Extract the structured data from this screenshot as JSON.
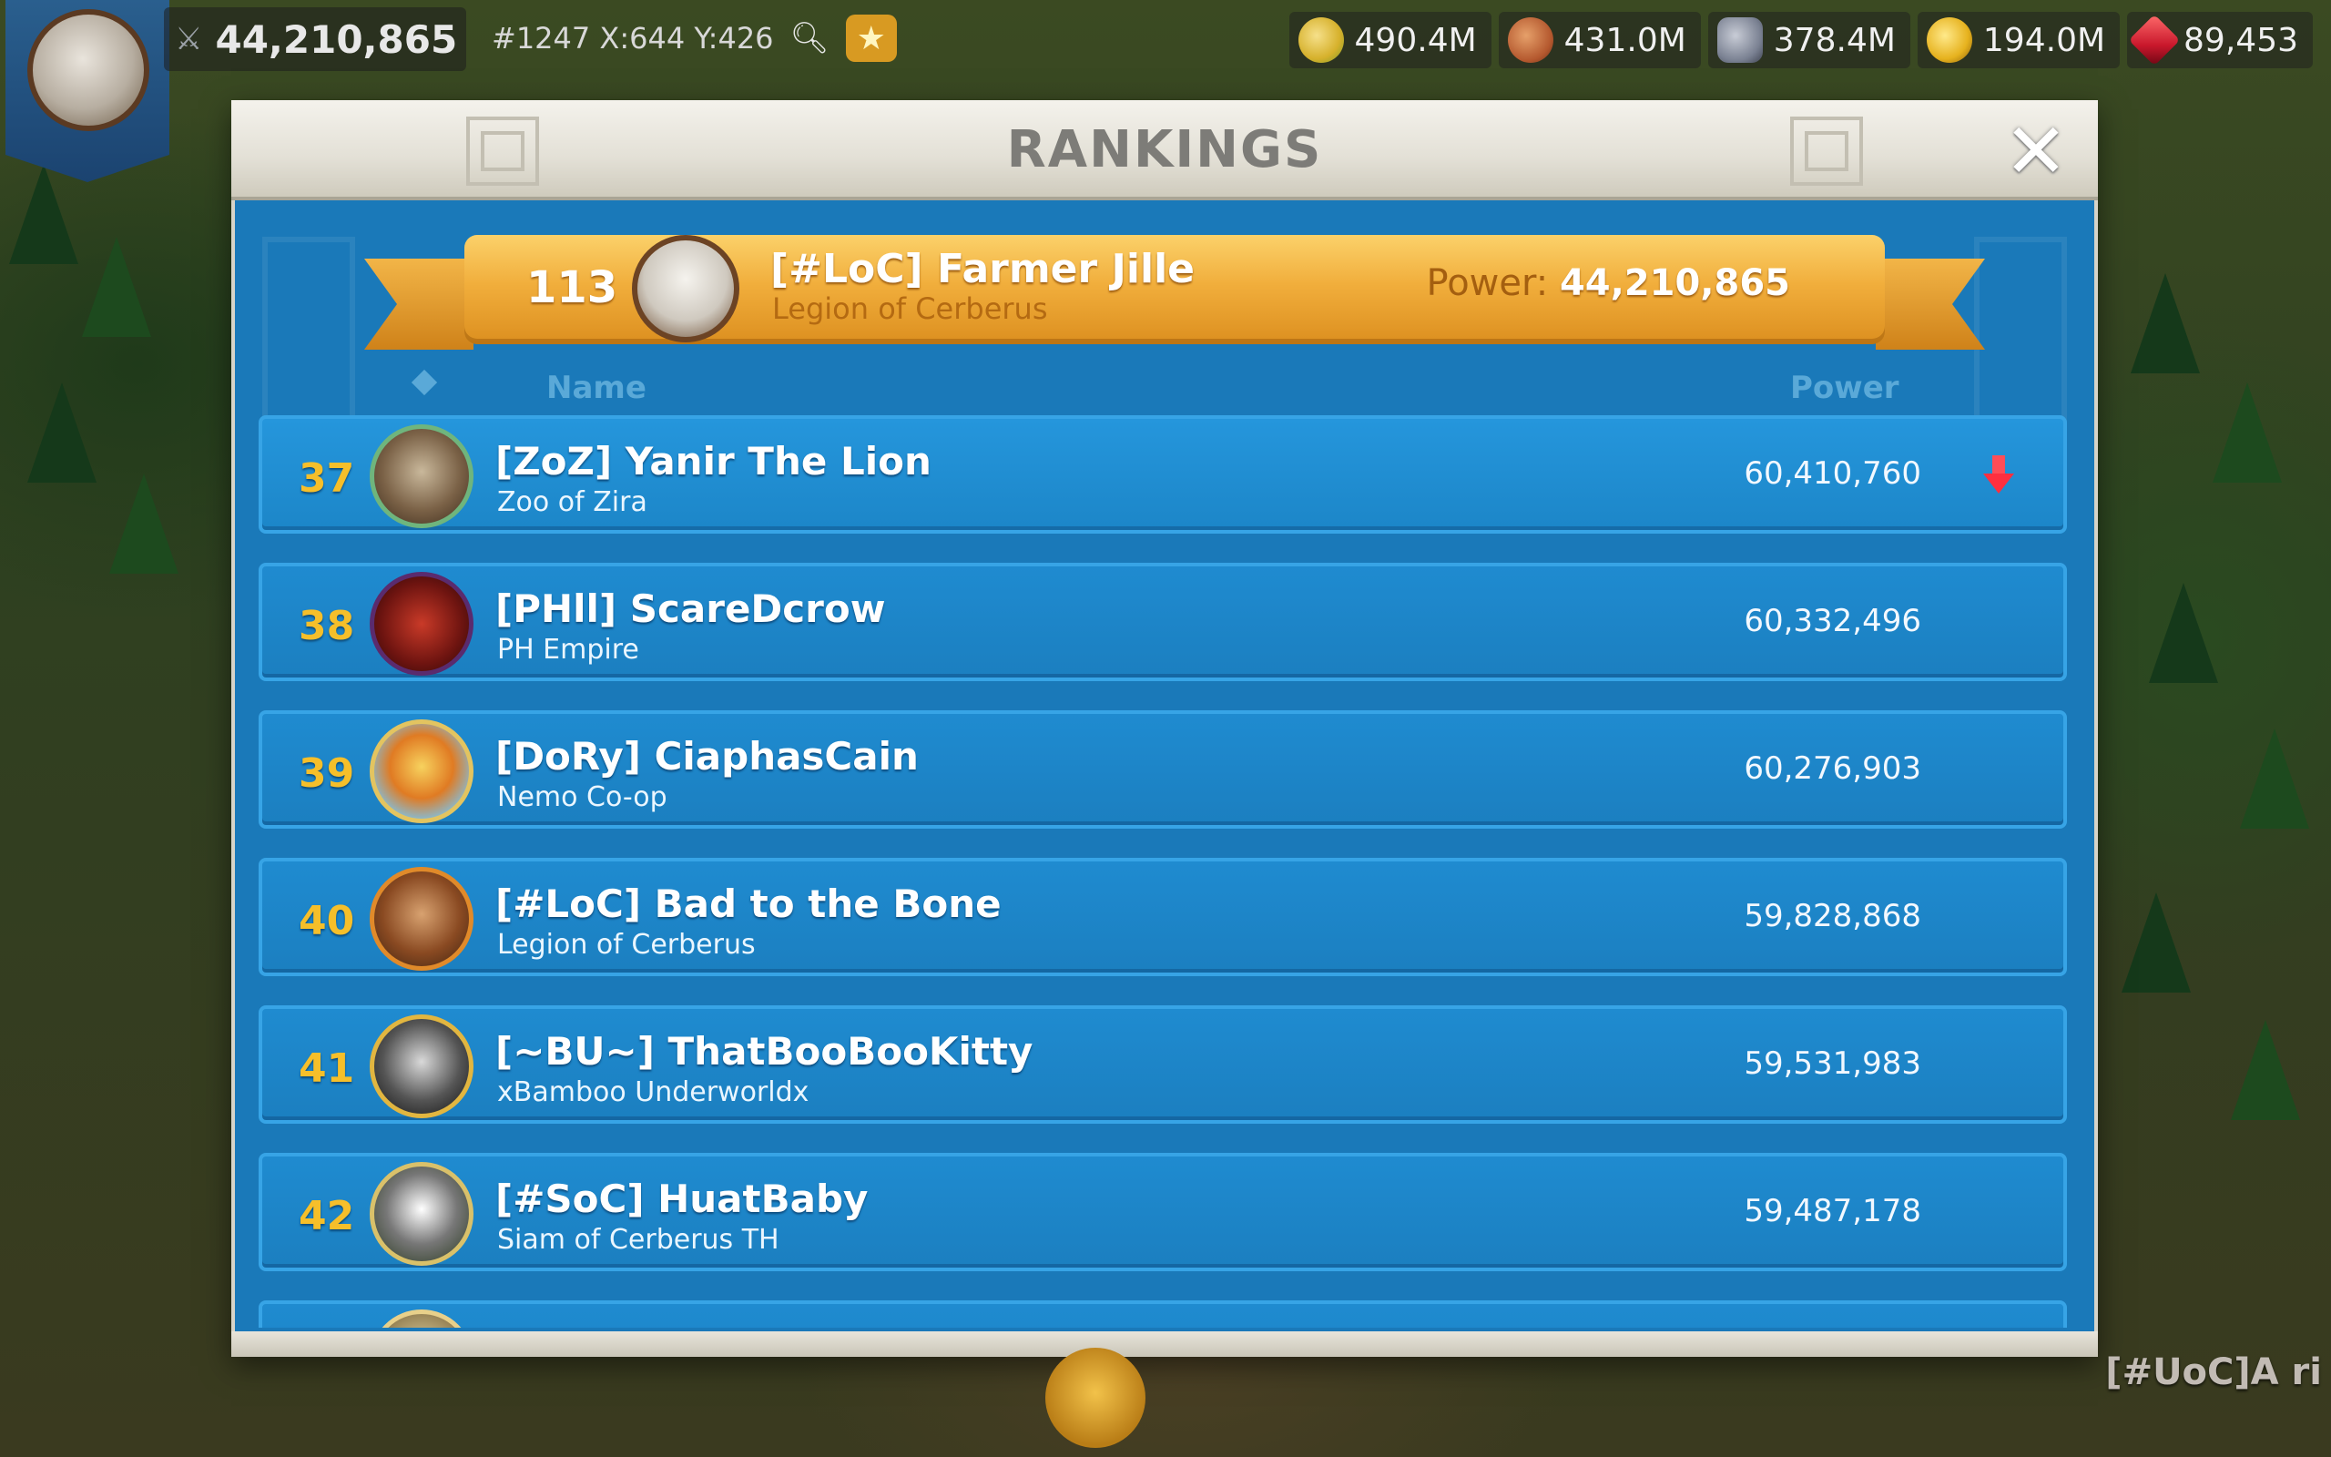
{
  "hud": {
    "power": "44,210,865",
    "coordinates": "#1247 X:644 Y:426",
    "resources": [
      {
        "icon": "corn-icon",
        "value": "490.4M"
      },
      {
        "icon": "wood-log-icon",
        "value": "431.0M"
      },
      {
        "icon": "stone-icon",
        "value": "378.4M"
      },
      {
        "icon": "gold-coin-icon",
        "value": "194.0M"
      },
      {
        "icon": "gem-icon",
        "value": "89,453"
      }
    ]
  },
  "modal": {
    "title": "RANKINGS",
    "close_label": "✕"
  },
  "my_rank": {
    "rank": "113",
    "name": "[#LoC] Farmer Jille",
    "alliance": "Legion of Cerberus",
    "power_label": "Power:",
    "power_value": "44,210,865"
  },
  "columns": {
    "name": "Name",
    "power": "Power"
  },
  "rows": [
    {
      "rank": "37",
      "name": "[ZoZ] Yanir The Lion",
      "alliance": "Zoo of Zira",
      "power": "60,410,760",
      "trend": "down"
    },
    {
      "rank": "38",
      "name": "[PHll] ScareDcrow",
      "alliance": "PH Empire",
      "power": "60,332,496"
    },
    {
      "rank": "39",
      "name": "[DoRy] CiaphasCain",
      "alliance": "Nemo Co-op",
      "power": "60,276,903"
    },
    {
      "rank": "40",
      "name": "[#LoC] Bad to the Bone",
      "alliance": "Legion of Cerberus",
      "power": "59,828,868"
    },
    {
      "rank": "41",
      "name": "[~BU~] ThatBooBooKitty",
      "alliance": "xBamboo Underworldx",
      "power": "59,531,983"
    },
    {
      "rank": "42",
      "name": "[#SoC] HuatBaby",
      "alliance": "Siam of Cerberus TH",
      "power": "59,487,178"
    }
  ],
  "map_label": "[#UoC]A ri"
}
